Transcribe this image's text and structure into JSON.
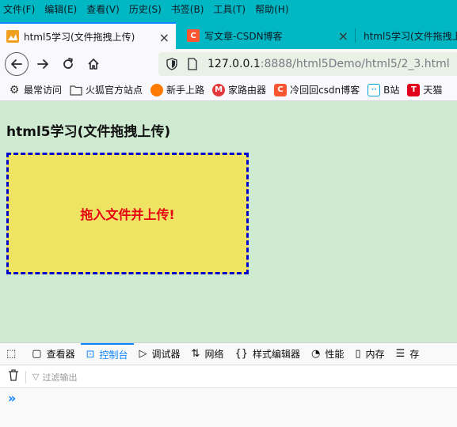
{
  "menu": [
    "文件(F)",
    "编辑(E)",
    "查看(V)",
    "历史(S)",
    "书签(B)",
    "工具(T)",
    "帮助(H)"
  ],
  "tabs": [
    {
      "label": "html5学习(文件拖拽上传)",
      "close": "×"
    },
    {
      "label": "写文章-CSDN博客",
      "close": "×"
    },
    {
      "label": "html5学习(文件拖拽上传"
    }
  ],
  "url": {
    "host": "127.0.0.1",
    "path": ":8888/html5Demo/html5/2_3.html"
  },
  "bookmarks": [
    "最常访问",
    "火狐官方站点",
    "新手上路",
    "家路由器",
    "冷回回csdn博客",
    "B站",
    "天猫"
  ],
  "page": {
    "title": "html5学习(文件拖拽上传)",
    "dropzone_text": "拖入文件并上传!"
  },
  "devtools": {
    "tabs": [
      "查看器",
      "控制台",
      "调试器",
      "网络",
      "样式编辑器",
      "性能",
      "内存",
      "存"
    ],
    "filter_placeholder": "过滤输出",
    "prompt": "»"
  },
  "colors": {
    "toolbar_accent": "#00b7c3",
    "content_bg": "#ceead0",
    "dropzone_bg": "#efe363",
    "dropzone_border": "#0000cc",
    "dropzone_text": "#e60012"
  }
}
